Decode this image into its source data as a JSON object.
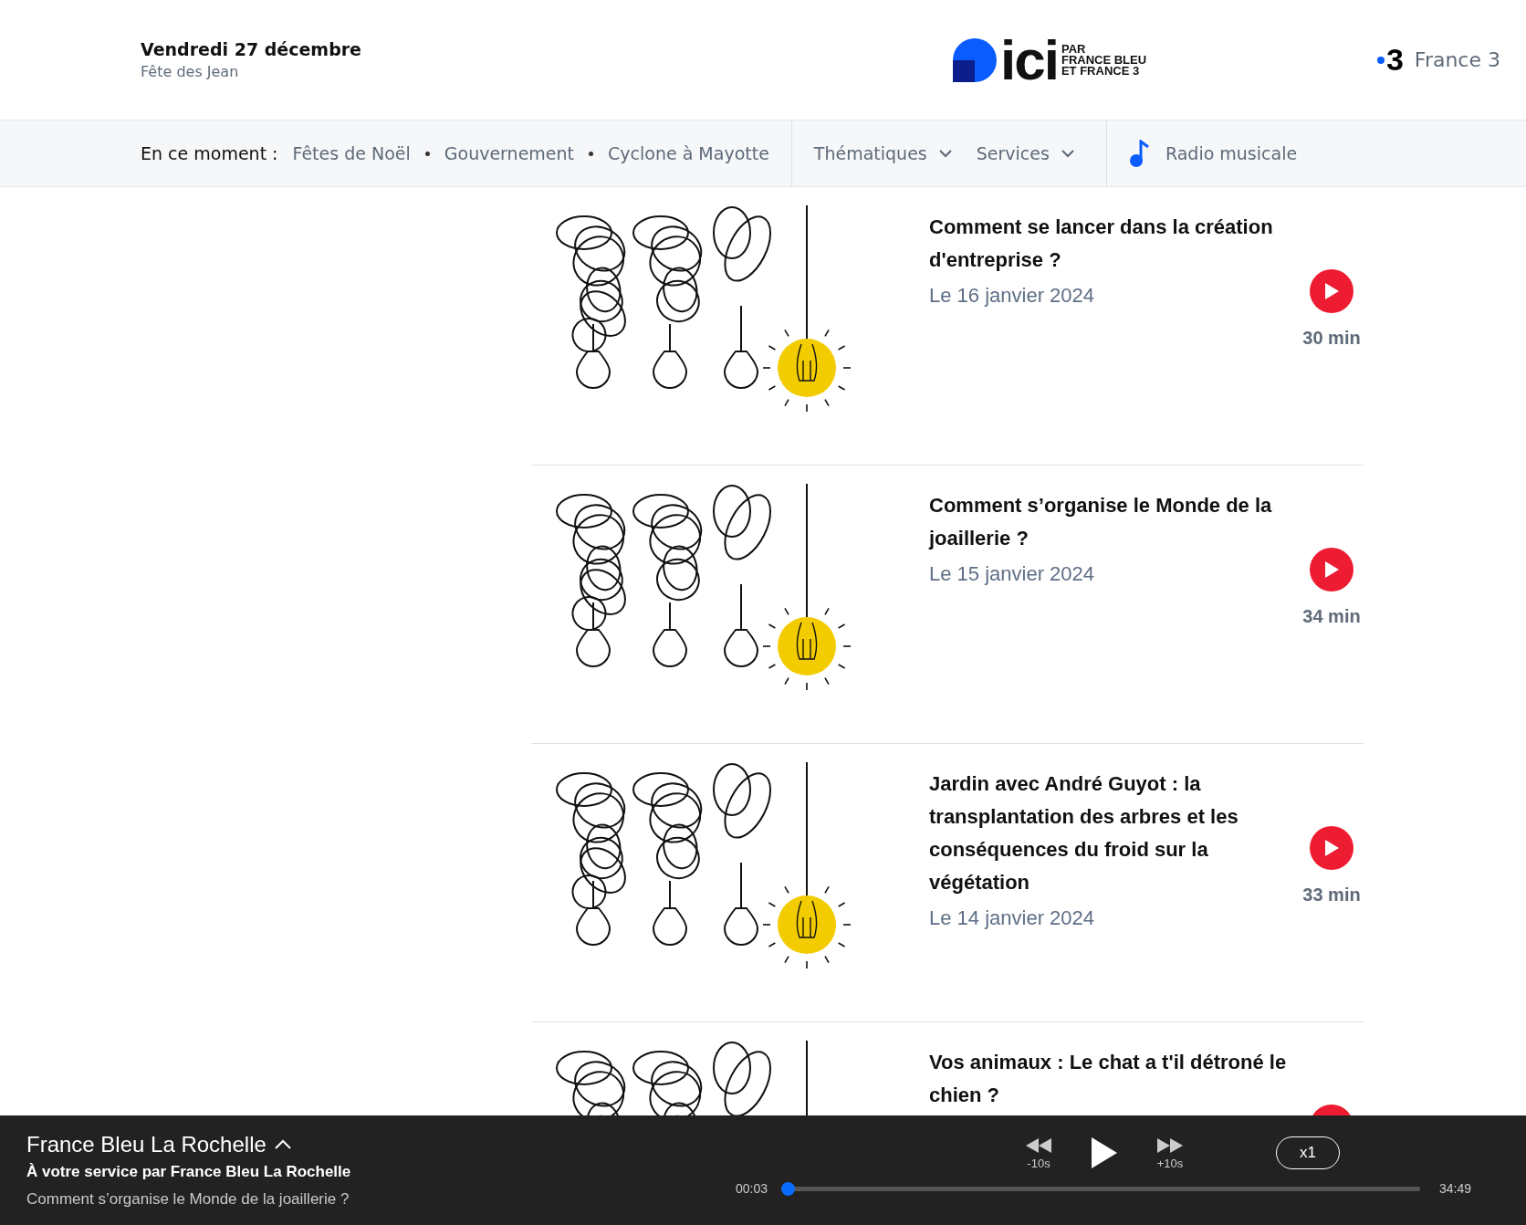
{
  "header": {
    "date": "Vendredi 27 décembre",
    "saint": "Fête des Jean",
    "logo": {
      "word": "ici",
      "tagline": [
        "PAR",
        "FRANCE BLEU",
        "ET FRANCE 3"
      ]
    },
    "partner": {
      "mark": "3",
      "label": "France 3"
    }
  },
  "nav": {
    "lead": "En ce moment :",
    "topics": [
      "Fêtes de Noël",
      "Gouvernement",
      "Cyclone à Mayotte"
    ],
    "menus": [
      "Thématiques",
      "Services"
    ],
    "radio": "Radio musicale"
  },
  "episodes": [
    {
      "title": "Comment se lancer dans la création d'entreprise ?",
      "date": "Le 16 janvier 2024",
      "duration": "30 min"
    },
    {
      "title": "Comment s’organise le Monde de la joaillerie ?",
      "date": "Le 15 janvier 2024",
      "duration": "34 min"
    },
    {
      "title": "Jardin avec André Guyot : la transplantation des arbres et les conséquences du froid sur la végétation",
      "date": "Le 14 janvier 2024",
      "duration": "33 min"
    },
    {
      "title": "Vos animaux : Le chat a t'il détroné le chien ?"
    }
  ],
  "player": {
    "station": "France Bleu La Rochelle",
    "show": "À votre service par France Bleu La Rochelle",
    "episode": "Comment s’organise le Monde de la joaillerie ?",
    "back": "-10s",
    "forward": "+10s",
    "speed": "x1",
    "elapsed": "00:03",
    "total": "34:49",
    "level": 0.002
  }
}
